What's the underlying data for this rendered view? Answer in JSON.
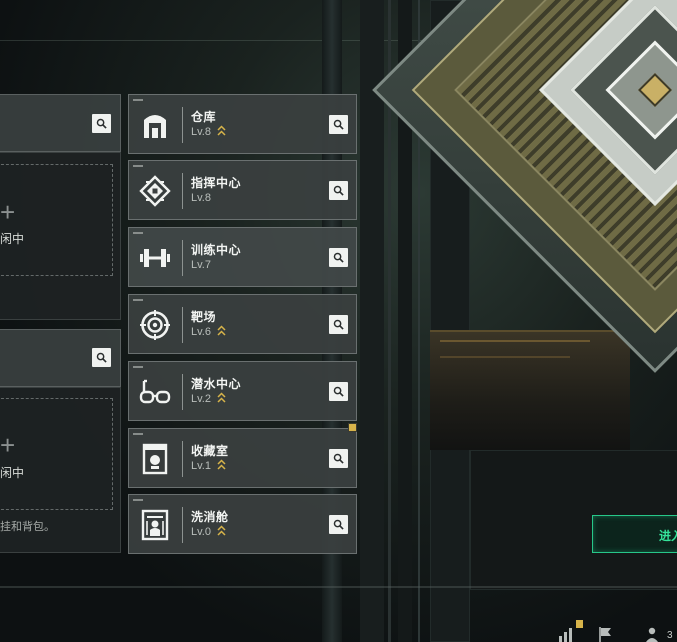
{
  "left_panels": {
    "idle_label_1": "闲中",
    "idle_label_2": "闲中",
    "hint": "挂和背包。"
  },
  "facilities": [
    {
      "name": "仓库",
      "level": "Lv.8",
      "icon": "warehouse-icon",
      "upgradable": true,
      "notice": false
    },
    {
      "name": "指挥中心",
      "level": "Lv.8",
      "icon": "command-center-icon",
      "upgradable": false,
      "notice": false
    },
    {
      "name": "训练中心",
      "level": "Lv.7",
      "icon": "dumbbell-icon",
      "upgradable": false,
      "notice": false
    },
    {
      "name": "靶场",
      "level": "Lv.6",
      "icon": "target-icon",
      "upgradable": true,
      "notice": false
    },
    {
      "name": "潜水中心",
      "level": "Lv.2",
      "icon": "diving-goggles-icon",
      "upgradable": true,
      "notice": false
    },
    {
      "name": "收藏室",
      "level": "Lv.1",
      "icon": "collection-room-icon",
      "upgradable": true,
      "notice": true
    },
    {
      "name": "洗消舱",
      "level": "Lv.0",
      "icon": "decontamination-pod-icon",
      "upgradable": true,
      "notice": false
    }
  ],
  "enter_button": {
    "label": "进入"
  },
  "tray": {
    "count": "3"
  },
  "colors": {
    "accent_green": "#27c789",
    "upgrade_gold": "#d7b44a",
    "panel_bg": "#3a3f3f"
  }
}
